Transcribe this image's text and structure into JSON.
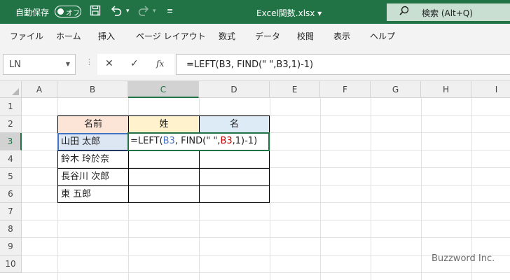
{
  "titlebar": {
    "autosave_label": "自動保存",
    "toggle_label": "オフ",
    "save_icon": "save-icon",
    "undo_icon": "undo-icon",
    "redo_icon": "redo-icon",
    "filename": "Excel関数.xlsx ▾",
    "search_label": "検索 (Alt+Q)"
  },
  "menu": [
    "ファイル",
    "ホーム",
    "挿入",
    "ページ レイアウト",
    "数式",
    "データ",
    "校閲",
    "表示",
    "ヘルプ"
  ],
  "formula_bar": {
    "name_box": "LN",
    "cancel_symbol": "✕",
    "enter_symbol": "✓",
    "fx_label": "fx",
    "formula": "=LEFT(B3, FIND(\" \",B3,1)-1)"
  },
  "columns": [
    "A",
    "B",
    "C",
    "D",
    "E",
    "F",
    "G",
    "H",
    "I"
  ],
  "rows": [
    "1",
    "2",
    "3",
    "4",
    "5",
    "6",
    "7",
    "8",
    "9",
    "10"
  ],
  "table": {
    "headers": [
      "名前",
      "姓",
      "名"
    ],
    "names": [
      "山田 太郎",
      "鈴木 玲於奈",
      "長谷川 次郎",
      "東 五郎"
    ]
  },
  "edit_cell": {
    "p1": "=LEFT(",
    "p2": "B3",
    "p3": ", FIND(\" \",",
    "p4": "B3",
    "p5": ",1)-1)"
  },
  "watermark": "Buzzword Inc.",
  "colors": {
    "title_green": "#217346",
    "header_b": "#fce4d6",
    "header_c": "#fff2cc",
    "header_d": "#ddebf7",
    "ref_blue": "#4472c4",
    "ref_red": "#c00000"
  }
}
